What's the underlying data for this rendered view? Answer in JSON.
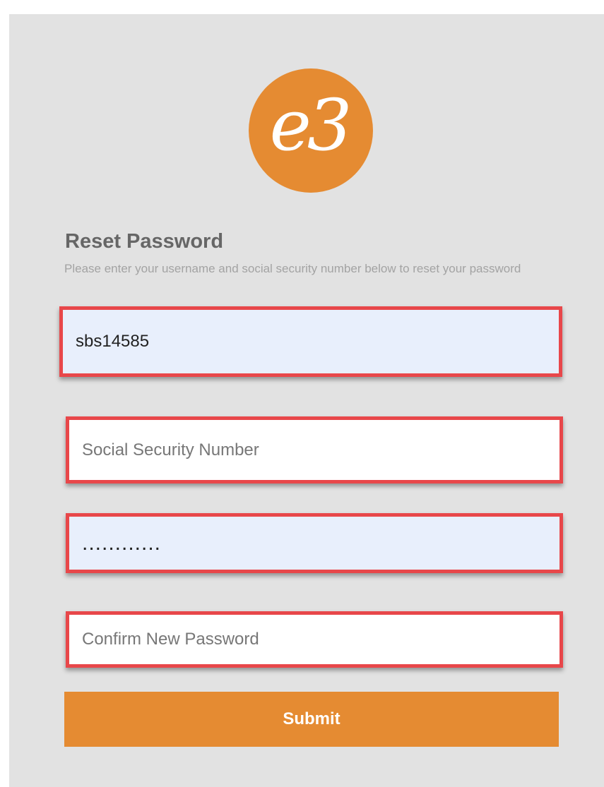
{
  "logo": {
    "text": "e3",
    "color": "#e58b32"
  },
  "form": {
    "title": "Reset Password",
    "instructions": "Please enter your username and social security number below to reset your password",
    "username": {
      "value": "sbs14585",
      "placeholder": ""
    },
    "ssn": {
      "value": "",
      "placeholder": "Social Security Number"
    },
    "new_password": {
      "value": "............",
      "placeholder": ""
    },
    "confirm_password": {
      "value": "",
      "placeholder": "Confirm New Password"
    },
    "submit_label": "Submit"
  },
  "colors": {
    "accent": "#e58b32",
    "panel_background": "#e2e2e2",
    "highlight_border": "#e8474a",
    "autofill_background": "#e8effc"
  }
}
